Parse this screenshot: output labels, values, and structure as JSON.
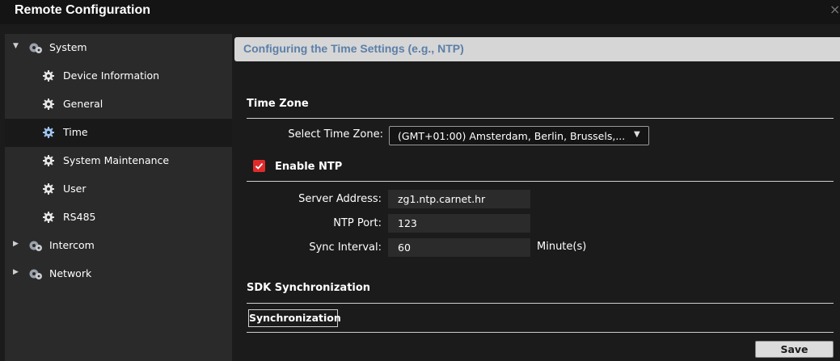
{
  "window": {
    "title": "Remote Configuration",
    "close_glyph": "×"
  },
  "sidebar": {
    "items": [
      {
        "label": "System",
        "level": 0,
        "expanded": true,
        "icon": "gears-icon"
      },
      {
        "label": "Device Information",
        "level": 1,
        "icon": "gear-icon"
      },
      {
        "label": "General",
        "level": 1,
        "icon": "gear-icon"
      },
      {
        "label": "Time",
        "level": 1,
        "selected": true,
        "icon": "gear-icon"
      },
      {
        "label": "System Maintenance",
        "level": 1,
        "icon": "gear-icon"
      },
      {
        "label": "User",
        "level": 1,
        "icon": "gear-icon"
      },
      {
        "label": "RS485",
        "level": 1,
        "icon": "gear-icon"
      },
      {
        "label": "Intercom",
        "level": 0,
        "expanded": false,
        "icon": "gears-icon"
      },
      {
        "label": "Network",
        "level": 0,
        "expanded": false,
        "icon": "gears-icon"
      }
    ]
  },
  "main": {
    "header_title": "Configuring the Time Settings (e.g., NTP)",
    "time_zone": {
      "section_title": "Time Zone",
      "select_label": "Select Time Zone:",
      "select_value": "(GMT+01:00) Amsterdam, Berlin, Brussels,..."
    },
    "ntp": {
      "enable_label": "Enable NTP",
      "enabled": true,
      "server_label": "Server Address:",
      "server_value": "zg1.ntp.carnet.hr",
      "port_label": "NTP Port:",
      "port_value": "123",
      "interval_label": "Sync Interval:",
      "interval_value": "60",
      "interval_unit": "Minute(s)"
    },
    "sdk": {
      "section_title": "SDK Synchronization",
      "button_label": "Synchronization"
    },
    "save_label": "Save"
  },
  "colors": {
    "accent_red": "#e02b2b",
    "header_text": "#5b7fa8",
    "header_bg": "#d6d6d6",
    "sidebar_bg": "#2a2a2a",
    "selected_bg": "#191919",
    "content_bg": "#1b1b1b"
  }
}
